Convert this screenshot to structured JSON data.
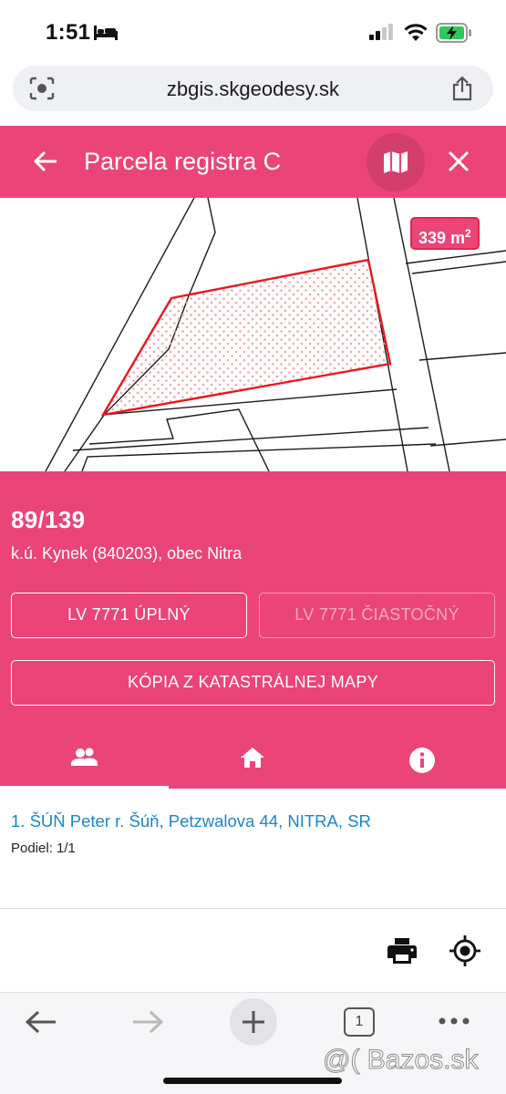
{
  "status_bar": {
    "time": "1:51"
  },
  "browser": {
    "url": "zbgis.skgeodesy.sk",
    "tab_count": "1"
  },
  "header": {
    "title": "Parcela registra C"
  },
  "map": {
    "area_value": "339 m",
    "area_sup": "2"
  },
  "parcel": {
    "number": "89/139",
    "location": "k.ú. Kynek (840203), obec Nitra"
  },
  "buttons": {
    "lv_full": "LV 7771 ÚPLNÝ",
    "lv_partial": "LV 7771 ČIASTOČNÝ",
    "copy_map": "KÓPIA Z KATASTRÁLNEJ MAPY"
  },
  "tabs": [
    {
      "icon": "people-icon",
      "active": true
    },
    {
      "icon": "home-icon",
      "active": false
    },
    {
      "icon": "info-icon",
      "active": false
    }
  ],
  "owners": [
    {
      "line": "1. ŠÚŇ Peter r. Šúň, Petzwalova 44, NITRA, SR",
      "share": "Podiel: 1/1"
    }
  ],
  "watermark": "@( Bazos.sk",
  "colors": {
    "accent": "#eb4479",
    "parcel_outline": "#e8181f",
    "link": "#1a86c8"
  }
}
